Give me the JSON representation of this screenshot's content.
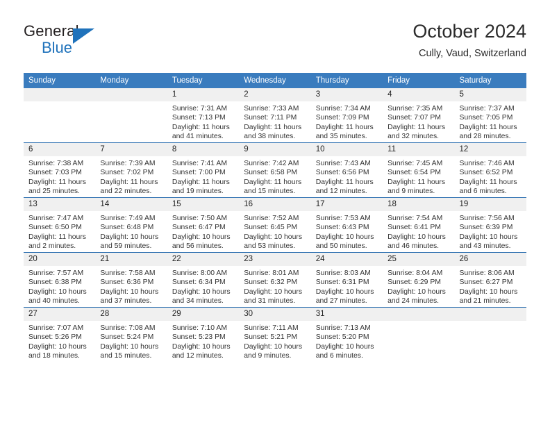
{
  "brand": {
    "name_top": "General",
    "name_bottom": "Blue",
    "triangle_color": "#1f72bb",
    "text_color": "#231f20"
  },
  "header": {
    "title": "October 2024",
    "location": "Cully, Vaud, Switzerland"
  },
  "theme": {
    "header_row_bg": "#3a7cbe",
    "row_divider": "#2c6fb0",
    "daynum_bg": "#f0f0f0",
    "page_bg": "#ffffff"
  },
  "weekday_headers": [
    "Sunday",
    "Monday",
    "Tuesday",
    "Wednesday",
    "Thursday",
    "Friday",
    "Saturday"
  ],
  "weeks": [
    [
      {
        "day": "",
        "lines": []
      },
      {
        "day": "",
        "lines": []
      },
      {
        "day": "1",
        "lines": [
          "Sunrise: 7:31 AM",
          "Sunset: 7:13 PM",
          "Daylight: 11 hours",
          "and 41 minutes."
        ]
      },
      {
        "day": "2",
        "lines": [
          "Sunrise: 7:33 AM",
          "Sunset: 7:11 PM",
          "Daylight: 11 hours",
          "and 38 minutes."
        ]
      },
      {
        "day": "3",
        "lines": [
          "Sunrise: 7:34 AM",
          "Sunset: 7:09 PM",
          "Daylight: 11 hours",
          "and 35 minutes."
        ]
      },
      {
        "day": "4",
        "lines": [
          "Sunrise: 7:35 AM",
          "Sunset: 7:07 PM",
          "Daylight: 11 hours",
          "and 32 minutes."
        ]
      },
      {
        "day": "5",
        "lines": [
          "Sunrise: 7:37 AM",
          "Sunset: 7:05 PM",
          "Daylight: 11 hours",
          "and 28 minutes."
        ]
      }
    ],
    [
      {
        "day": "6",
        "lines": [
          "Sunrise: 7:38 AM",
          "Sunset: 7:03 PM",
          "Daylight: 11 hours",
          "and 25 minutes."
        ]
      },
      {
        "day": "7",
        "lines": [
          "Sunrise: 7:39 AM",
          "Sunset: 7:02 PM",
          "Daylight: 11 hours",
          "and 22 minutes."
        ]
      },
      {
        "day": "8",
        "lines": [
          "Sunrise: 7:41 AM",
          "Sunset: 7:00 PM",
          "Daylight: 11 hours",
          "and 19 minutes."
        ]
      },
      {
        "day": "9",
        "lines": [
          "Sunrise: 7:42 AM",
          "Sunset: 6:58 PM",
          "Daylight: 11 hours",
          "and 15 minutes."
        ]
      },
      {
        "day": "10",
        "lines": [
          "Sunrise: 7:43 AM",
          "Sunset: 6:56 PM",
          "Daylight: 11 hours",
          "and 12 minutes."
        ]
      },
      {
        "day": "11",
        "lines": [
          "Sunrise: 7:45 AM",
          "Sunset: 6:54 PM",
          "Daylight: 11 hours",
          "and 9 minutes."
        ]
      },
      {
        "day": "12",
        "lines": [
          "Sunrise: 7:46 AM",
          "Sunset: 6:52 PM",
          "Daylight: 11 hours",
          "and 6 minutes."
        ]
      }
    ],
    [
      {
        "day": "13",
        "lines": [
          "Sunrise: 7:47 AM",
          "Sunset: 6:50 PM",
          "Daylight: 11 hours",
          "and 2 minutes."
        ]
      },
      {
        "day": "14",
        "lines": [
          "Sunrise: 7:49 AM",
          "Sunset: 6:48 PM",
          "Daylight: 10 hours",
          "and 59 minutes."
        ]
      },
      {
        "day": "15",
        "lines": [
          "Sunrise: 7:50 AM",
          "Sunset: 6:47 PM",
          "Daylight: 10 hours",
          "and 56 minutes."
        ]
      },
      {
        "day": "16",
        "lines": [
          "Sunrise: 7:52 AM",
          "Sunset: 6:45 PM",
          "Daylight: 10 hours",
          "and 53 minutes."
        ]
      },
      {
        "day": "17",
        "lines": [
          "Sunrise: 7:53 AM",
          "Sunset: 6:43 PM",
          "Daylight: 10 hours",
          "and 50 minutes."
        ]
      },
      {
        "day": "18",
        "lines": [
          "Sunrise: 7:54 AM",
          "Sunset: 6:41 PM",
          "Daylight: 10 hours",
          "and 46 minutes."
        ]
      },
      {
        "day": "19",
        "lines": [
          "Sunrise: 7:56 AM",
          "Sunset: 6:39 PM",
          "Daylight: 10 hours",
          "and 43 minutes."
        ]
      }
    ],
    [
      {
        "day": "20",
        "lines": [
          "Sunrise: 7:57 AM",
          "Sunset: 6:38 PM",
          "Daylight: 10 hours",
          "and 40 minutes."
        ]
      },
      {
        "day": "21",
        "lines": [
          "Sunrise: 7:58 AM",
          "Sunset: 6:36 PM",
          "Daylight: 10 hours",
          "and 37 minutes."
        ]
      },
      {
        "day": "22",
        "lines": [
          "Sunrise: 8:00 AM",
          "Sunset: 6:34 PM",
          "Daylight: 10 hours",
          "and 34 minutes."
        ]
      },
      {
        "day": "23",
        "lines": [
          "Sunrise: 8:01 AM",
          "Sunset: 6:32 PM",
          "Daylight: 10 hours",
          "and 31 minutes."
        ]
      },
      {
        "day": "24",
        "lines": [
          "Sunrise: 8:03 AM",
          "Sunset: 6:31 PM",
          "Daylight: 10 hours",
          "and 27 minutes."
        ]
      },
      {
        "day": "25",
        "lines": [
          "Sunrise: 8:04 AM",
          "Sunset: 6:29 PM",
          "Daylight: 10 hours",
          "and 24 minutes."
        ]
      },
      {
        "day": "26",
        "lines": [
          "Sunrise: 8:06 AM",
          "Sunset: 6:27 PM",
          "Daylight: 10 hours",
          "and 21 minutes."
        ]
      }
    ],
    [
      {
        "day": "27",
        "lines": [
          "Sunrise: 7:07 AM",
          "Sunset: 5:26 PM",
          "Daylight: 10 hours",
          "and 18 minutes."
        ]
      },
      {
        "day": "28",
        "lines": [
          "Sunrise: 7:08 AM",
          "Sunset: 5:24 PM",
          "Daylight: 10 hours",
          "and 15 minutes."
        ]
      },
      {
        "day": "29",
        "lines": [
          "Sunrise: 7:10 AM",
          "Sunset: 5:23 PM",
          "Daylight: 10 hours",
          "and 12 minutes."
        ]
      },
      {
        "day": "30",
        "lines": [
          "Sunrise: 7:11 AM",
          "Sunset: 5:21 PM",
          "Daylight: 10 hours",
          "and 9 minutes."
        ]
      },
      {
        "day": "31",
        "lines": [
          "Sunrise: 7:13 AM",
          "Sunset: 5:20 PM",
          "Daylight: 10 hours",
          "and 6 minutes."
        ]
      },
      {
        "day": "",
        "lines": []
      },
      {
        "day": "",
        "lines": []
      }
    ]
  ]
}
